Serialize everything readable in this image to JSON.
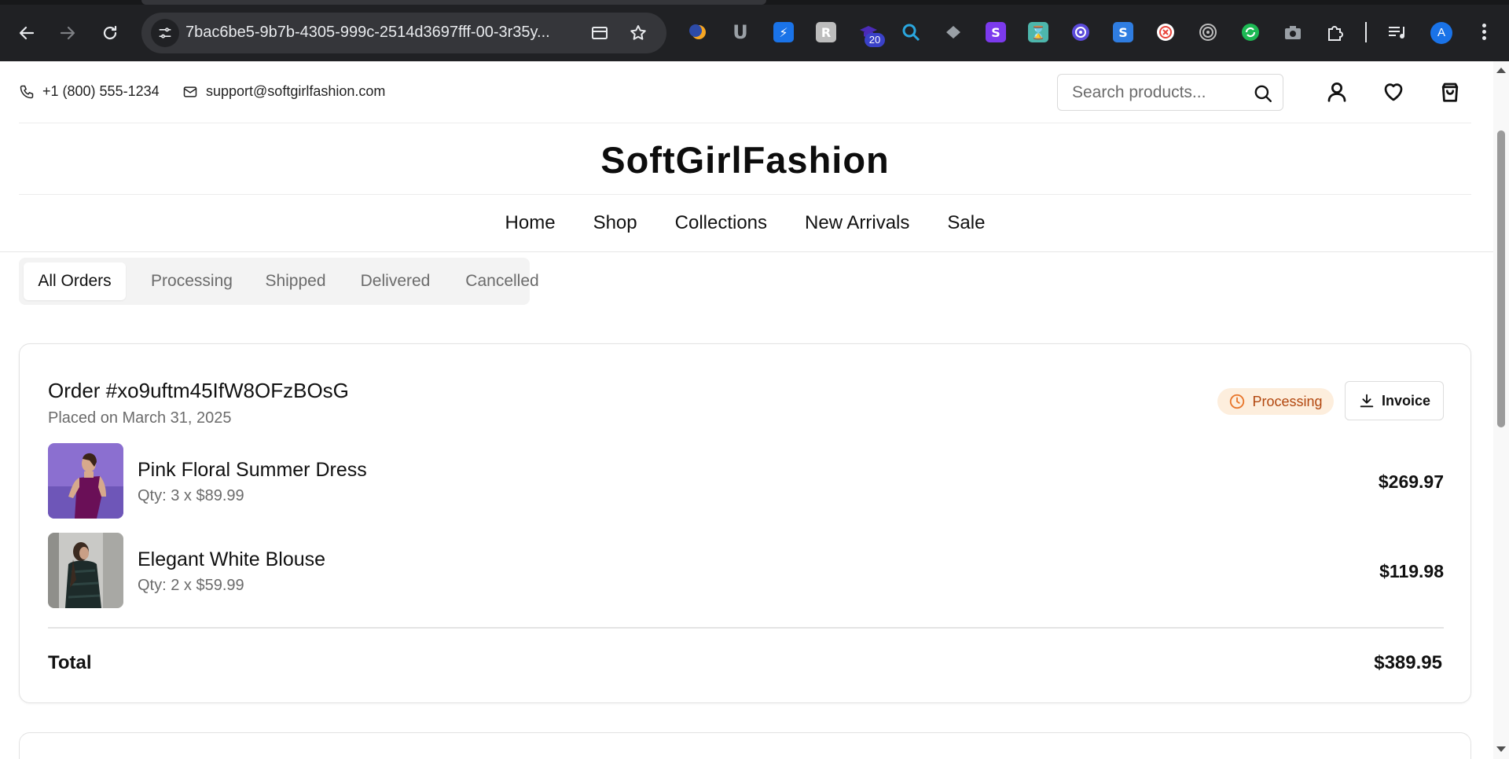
{
  "browser": {
    "url": "7bac6be5-9b7b-4305-999c-2514d3697fff-00-3r35y...",
    "extension_badge": "20",
    "profile_initial": "A"
  },
  "topbar": {
    "phone": "+1 (800) 555-1234",
    "email": "support@softgirlfashion.com",
    "search_placeholder": "Search products..."
  },
  "store": {
    "logo": "SoftGirlFashion",
    "nav": [
      "Home",
      "Shop",
      "Collections",
      "New Arrivals",
      "Sale"
    ]
  },
  "order_tabs": [
    "All Orders",
    "Processing",
    "Shipped",
    "Delivered",
    "Cancelled"
  ],
  "order": {
    "title": "Order #xo9uftm45IfW8OFzBOsG",
    "placed": "Placed on March 31, 2025",
    "status": "Processing",
    "invoice_label": "Invoice",
    "items": [
      {
        "name": "Pink Floral Summer Dress",
        "qty": "Qty: 3 x $89.99",
        "price": "$269.97"
      },
      {
        "name": "Elegant White Blouse",
        "qty": "Qty: 2 x $59.99",
        "price": "$119.98"
      }
    ],
    "total_label": "Total",
    "total_value": "$389.95"
  },
  "colors": {
    "status_bg": "#fdeedd",
    "status_text": "#b2470f",
    "browser_chrome": "#202124"
  }
}
